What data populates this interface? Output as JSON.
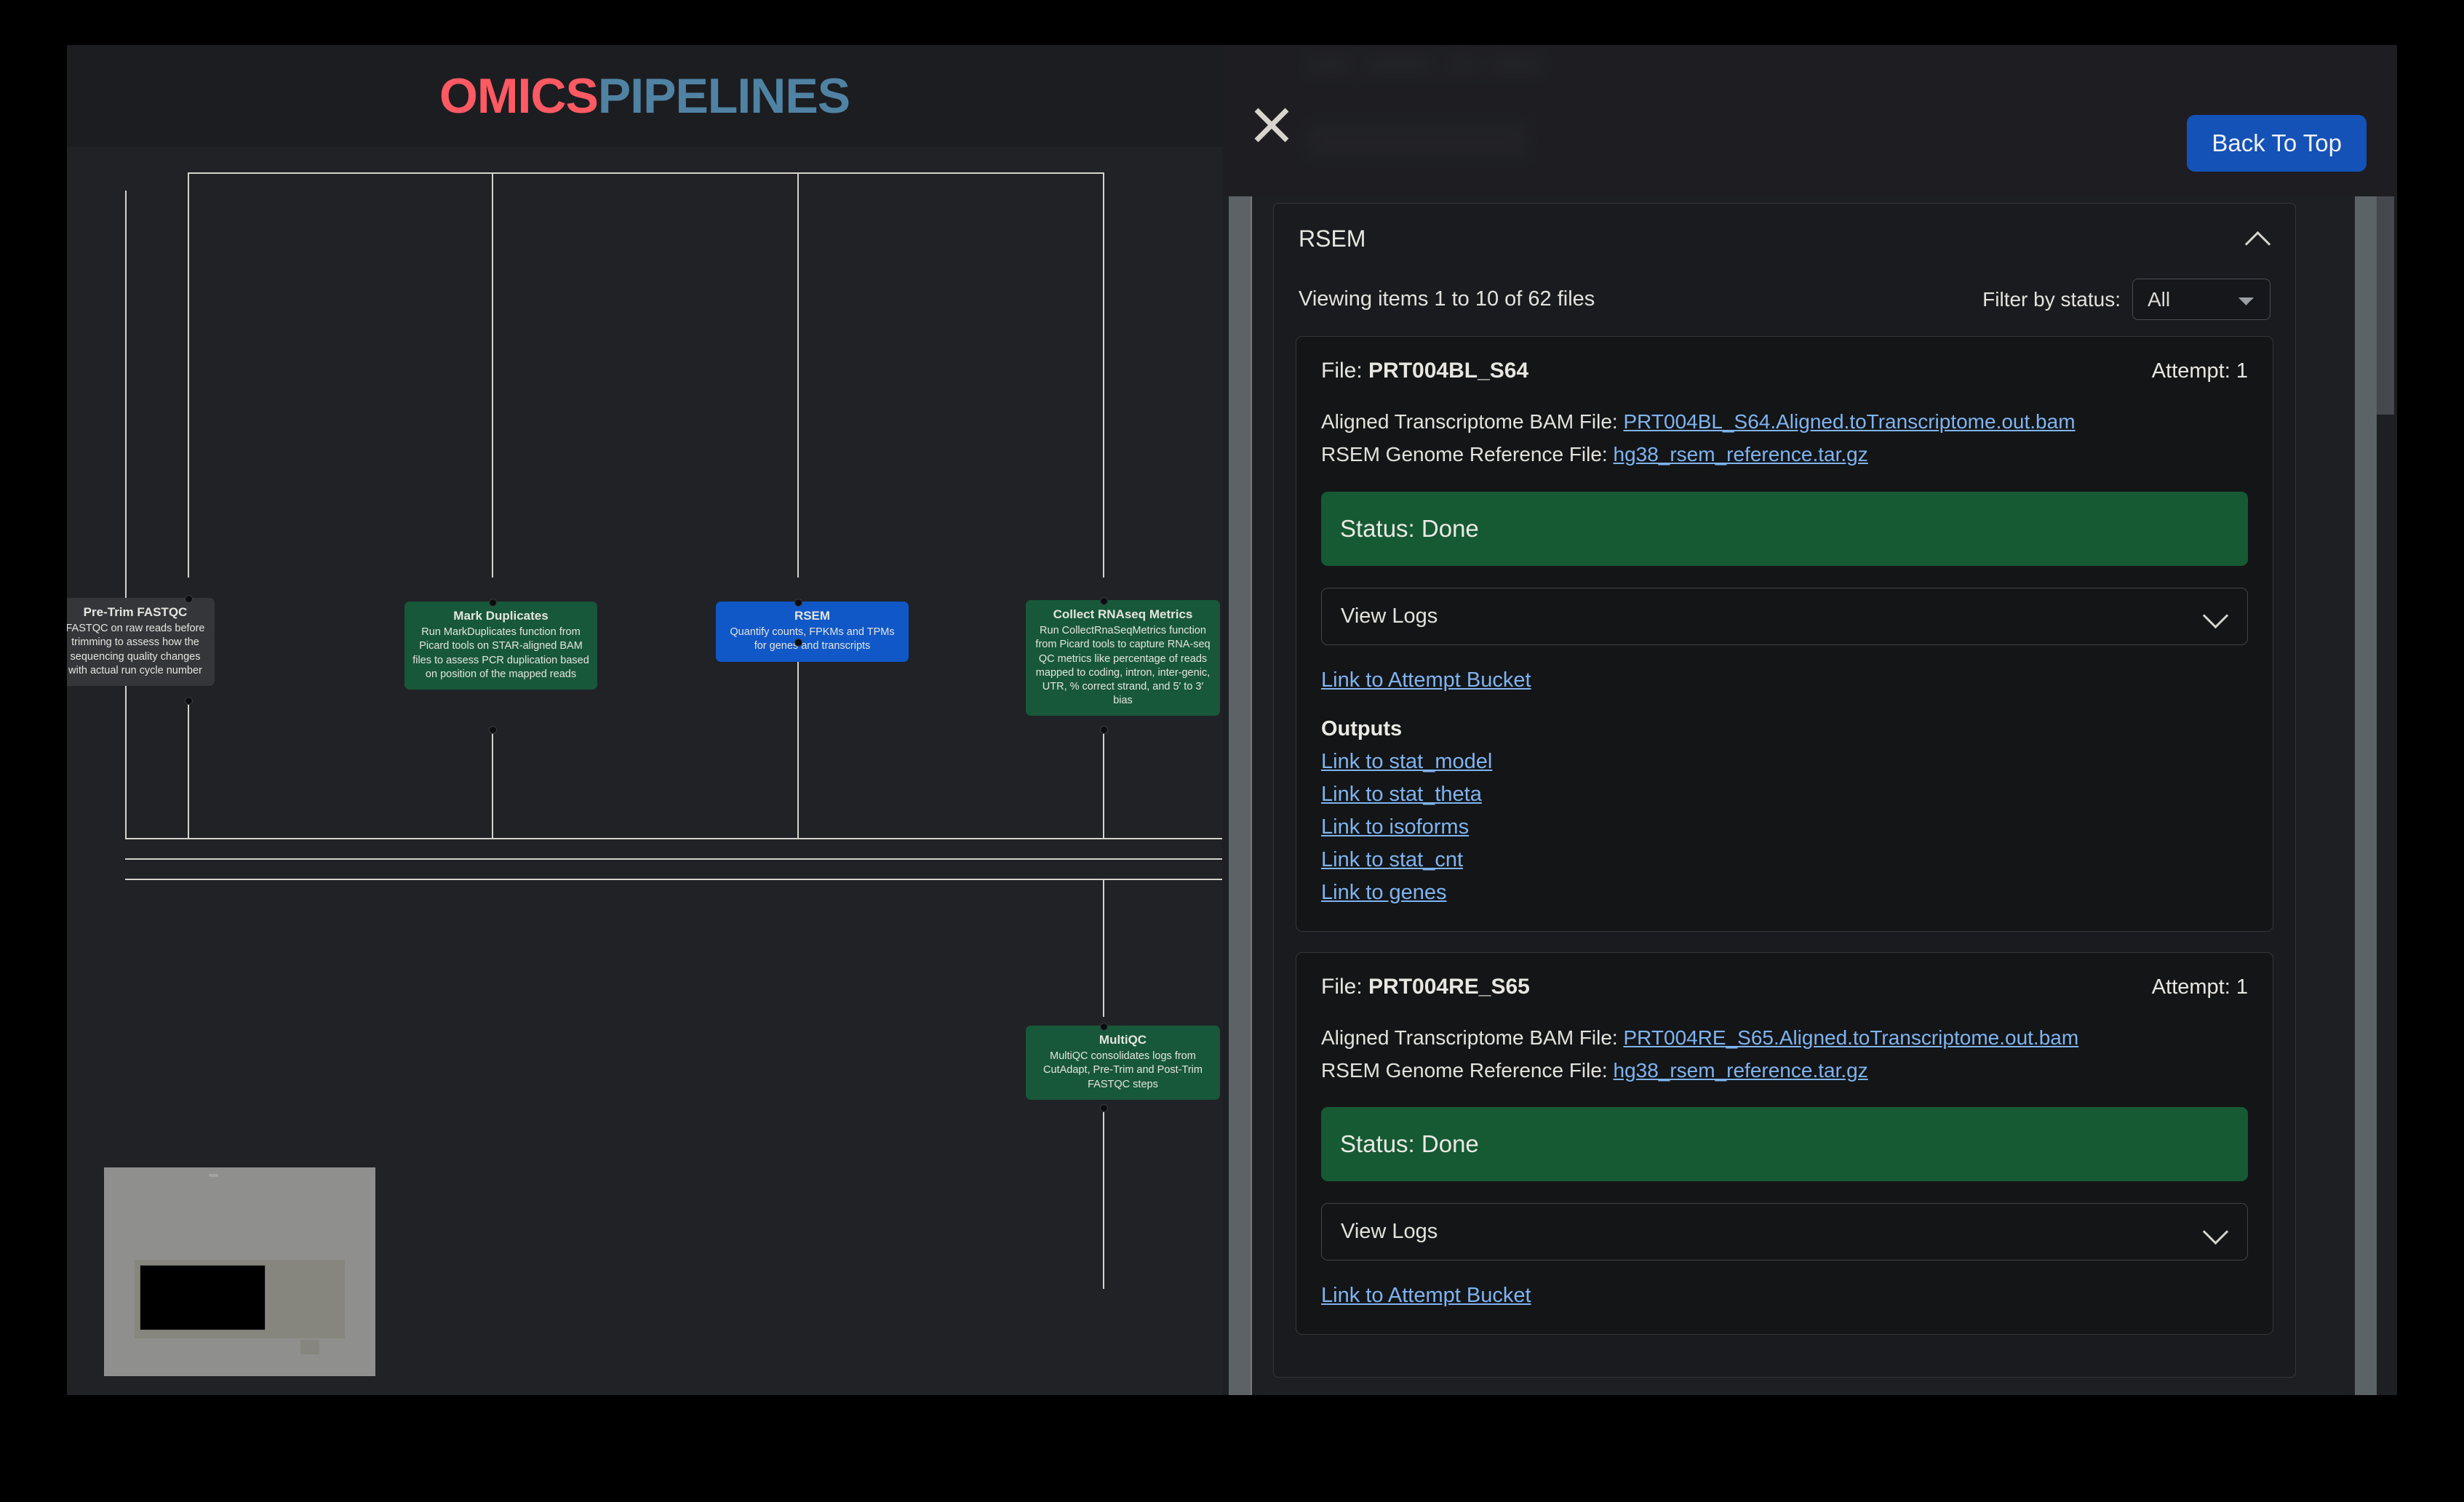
{
  "brand": {
    "part1": "OMICS",
    "part2": "PIPELINES",
    "color1": "#ff5a63",
    "color2": "#4f82a3"
  },
  "flow": {
    "nodes": [
      {
        "id": "pre-trim-fastqc",
        "title": "Pre-Trim FASTQC",
        "desc": "FASTQC on raw reads before trimming to assess how the sequencing quality changes with actual run cycle number",
        "color": "#34363a",
        "state": "default"
      },
      {
        "id": "mark-duplicates",
        "title": "Mark Duplicates",
        "desc": "Run MarkDuplicates function from Picard tools on STAR-aligned BAM files to assess PCR duplication based on position of the mapped reads",
        "color": "#18583a",
        "state": "default"
      },
      {
        "id": "rsem",
        "title": "RSEM",
        "desc": "Quantify counts, FPKMs and TPMs for genes and transcripts",
        "color": "#1058c8",
        "state": "selected"
      },
      {
        "id": "collect-rnaseq-metrics",
        "title": "Collect RNAseq Metrics",
        "desc": "Run CollectRnaSeqMetrics function from Picard tools to capture RNA-seq QC metrics like percentage of reads mapped to coding, intron, inter-genic, UTR, % correct strand, and 5′ to 3′ bias",
        "color": "#18583a",
        "state": "default"
      },
      {
        "id": "multiqc",
        "title": "MultiQC",
        "desc": "MultiQC consolidates logs from CutAdapt, Pre-Trim and Post-Trim FASTQC steps",
        "color": "#18583a",
        "state": "default"
      }
    ]
  },
  "panel": {
    "close_icon": "close-icon",
    "back_to_top_label": "Back To Top",
    "accent_blue": "#1552b8",
    "section": {
      "title": "RSEM",
      "collapse_icon": "chevron-up-icon",
      "viewing_items": "Viewing items 1 to 10 of 62 files",
      "filter_label": "Filter by status:",
      "filter_value": "All",
      "filter_options": [
        "All"
      ]
    },
    "files": [
      {
        "name_label": "File:",
        "name": "PRT004BL_S64",
        "attempt_label": "Attempt:",
        "attempt": "1",
        "bam_label": "Aligned Transcriptome BAM File:",
        "bam_link": "PRT004BL_S64.Aligned.toTranscriptome.out.bam",
        "ref_label": "RSEM Genome Reference File:",
        "ref_link": "hg38_rsem_reference.tar.gz",
        "status_text": "Status: Done",
        "status_color": "#155a32",
        "view_logs_label": "View Logs",
        "view_logs_icon": "chevron-down-icon",
        "bucket_link": "Link to Attempt Bucket",
        "outputs_title": "Outputs",
        "outputs": [
          "Link to stat_model",
          "Link to stat_theta",
          "Link to isoforms",
          "Link to stat_cnt",
          "Link to genes"
        ]
      },
      {
        "name_label": "File:",
        "name": "PRT004RE_S65",
        "attempt_label": "Attempt:",
        "attempt": "1",
        "bam_label": "Aligned Transcriptome BAM File:",
        "bam_link": "PRT004RE_S65.Aligned.toTranscriptome.out.bam",
        "ref_label": "RSEM Genome Reference File:",
        "ref_link": "hg38_rsem_reference.tar.gz",
        "status_text": "Status: Done",
        "status_color": "#155a32",
        "view_logs_label": "View Logs",
        "view_logs_icon": "chevron-down-icon",
        "bucket_link": "Link to Attempt Bucket",
        "outputs_title": "Outputs",
        "outputs": []
      }
    ]
  }
}
